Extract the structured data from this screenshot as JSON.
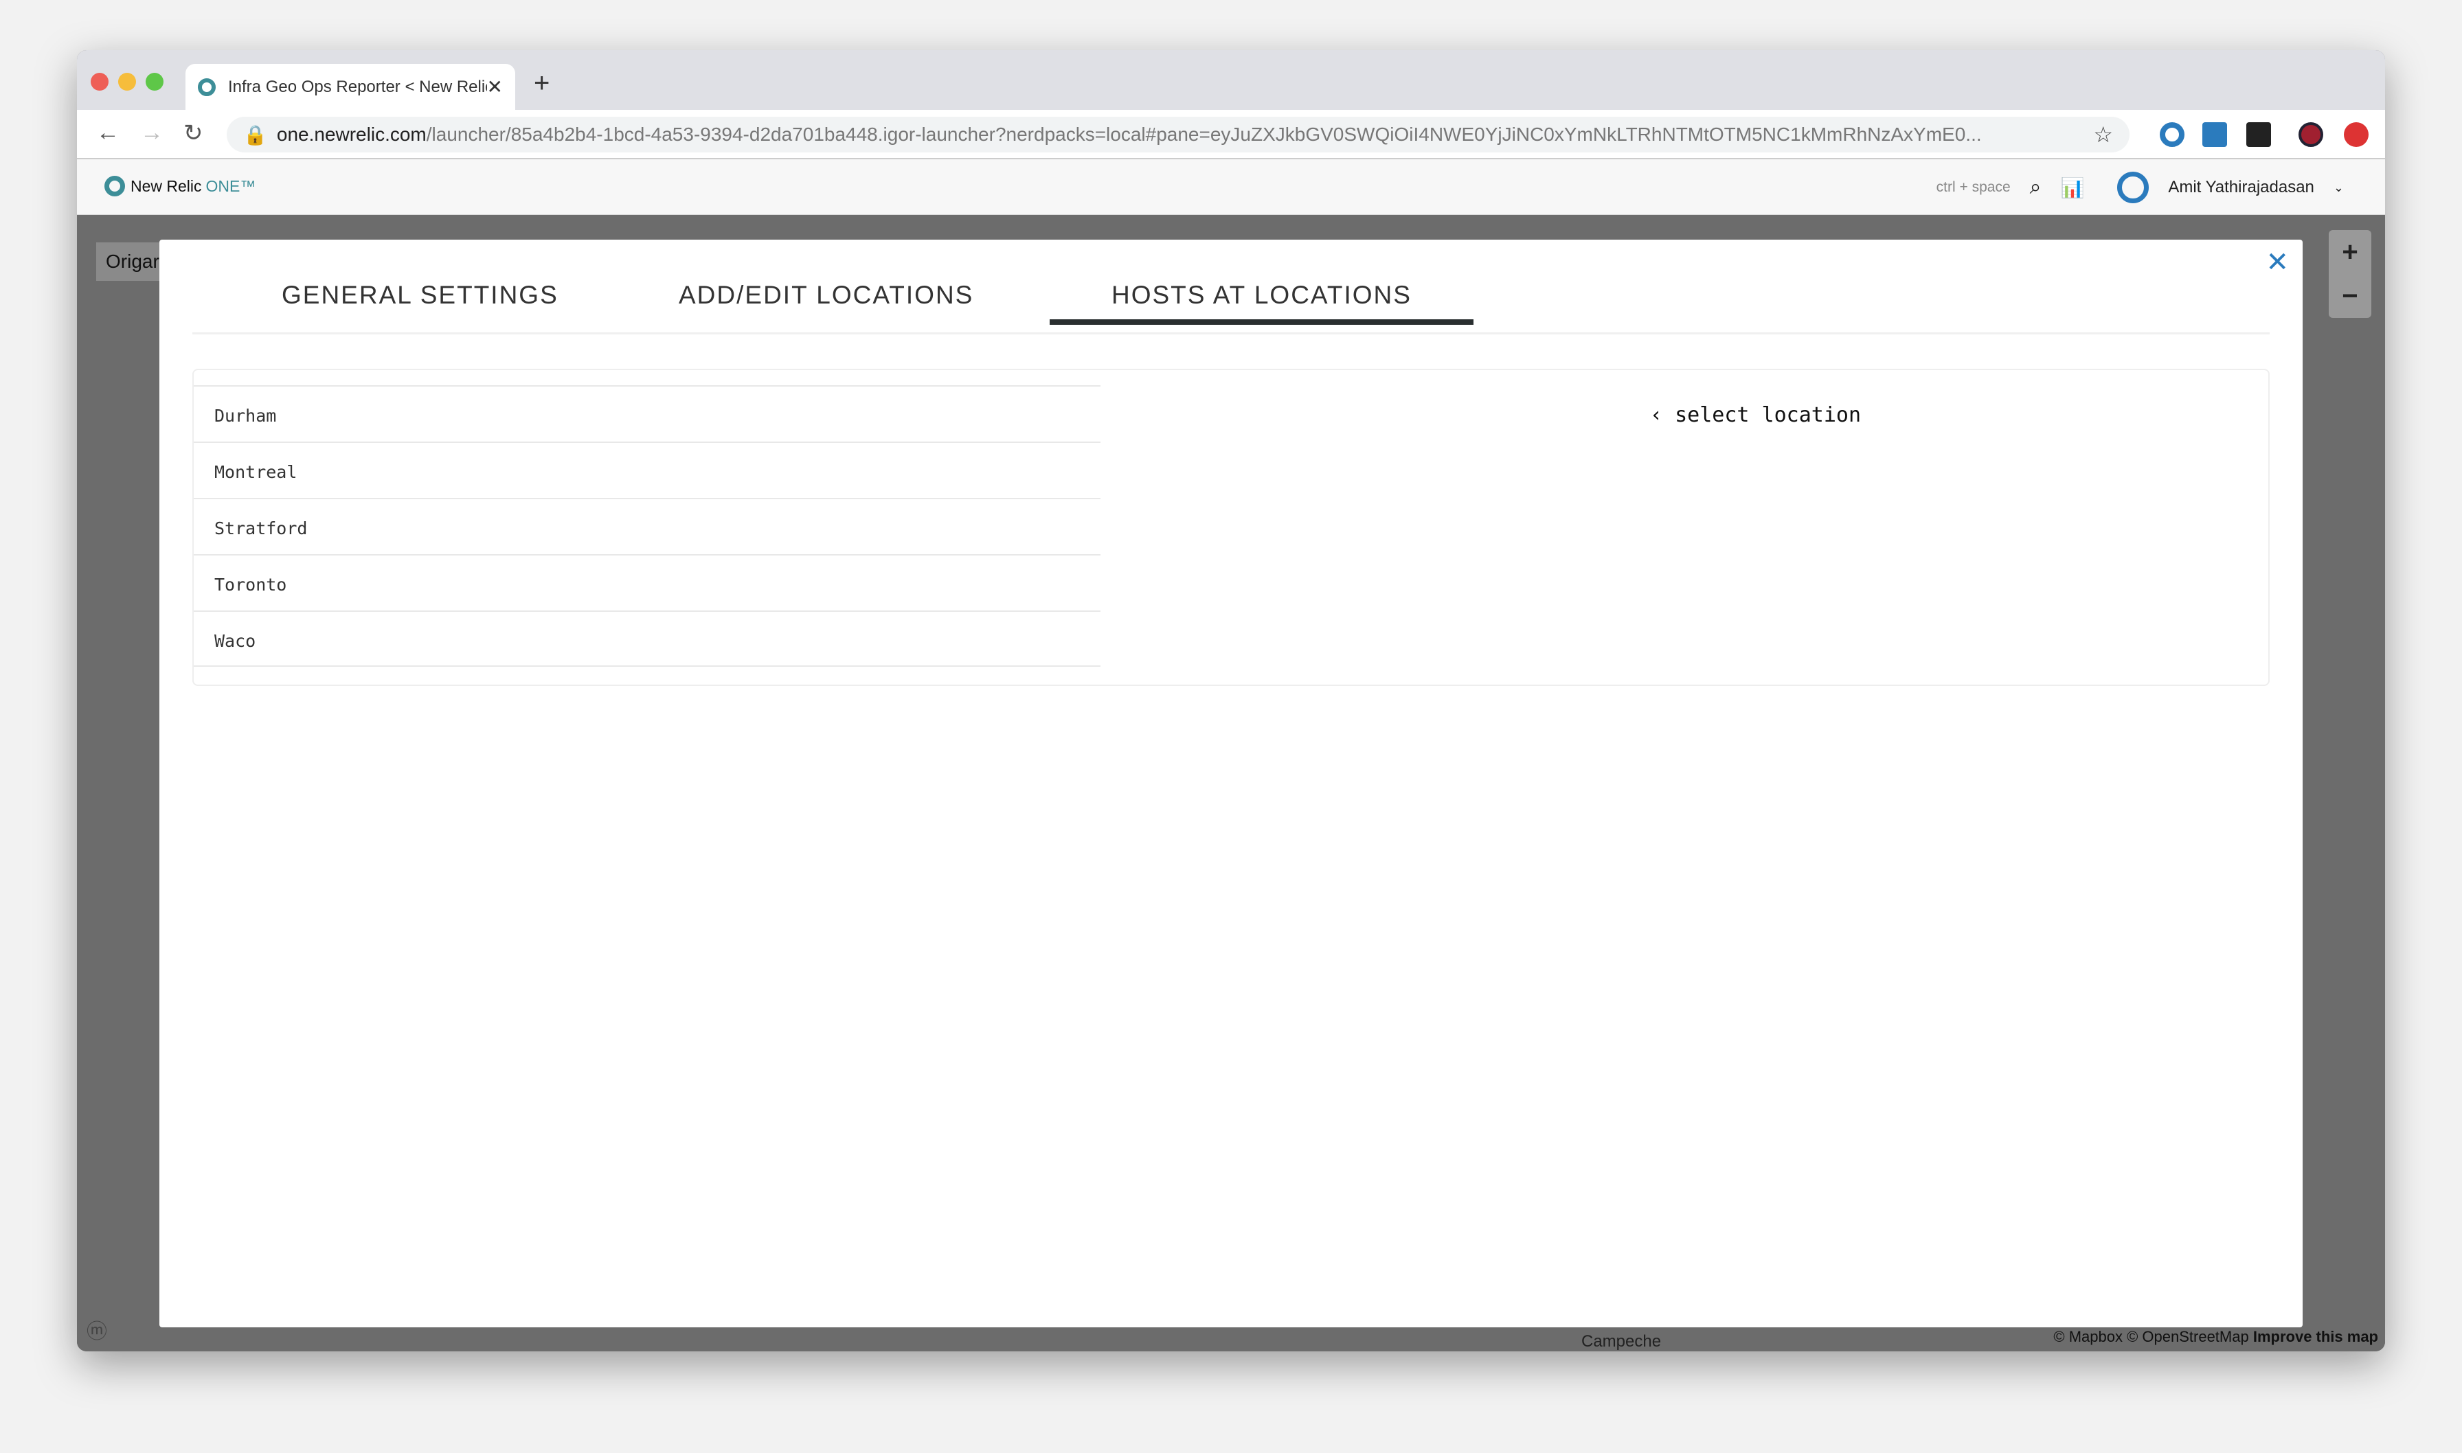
{
  "browser": {
    "tab_title": "Infra Geo Ops Reporter < New Relic One",
    "url_host": "one.newrelic.com",
    "url_path": "/launcher/85a4b2b4-1bcd-4a53-9394-d2da701ba448.igor-launcher?nerdpacks=local#pane=eyJuZXJkbGV0SWQiOiI4NWE0YjJiNC0xYmNkLTRhNTMtOTM5NC1kMmRhNzAxYmE0..."
  },
  "header": {
    "logo_text": "New Relic",
    "logo_one": "ONE™",
    "shortcut_hint": "ctrl + space",
    "user_name": "Amit Yathirajadasan"
  },
  "map": {
    "origin_label": "Origar",
    "attribution": "© Mapbox © OpenStreetMap",
    "improve": "Improve this map",
    "place_label": "Campeche",
    "mapbox_logo": "mapbox"
  },
  "modal": {
    "tabs": [
      {
        "label": "GENERAL SETTINGS"
      },
      {
        "label": "ADD/EDIT LOCATIONS"
      },
      {
        "label": "HOSTS AT LOCATIONS",
        "active": true
      }
    ],
    "locations": [
      "Durham",
      "Montreal",
      "Stratford",
      "Toronto",
      "Waco"
    ],
    "select_prompt": "select location"
  },
  "colors": {
    "accent": "#2b7bbd",
    "brand": "#3d8e98",
    "active_tab_underline": "#2a2f30"
  }
}
